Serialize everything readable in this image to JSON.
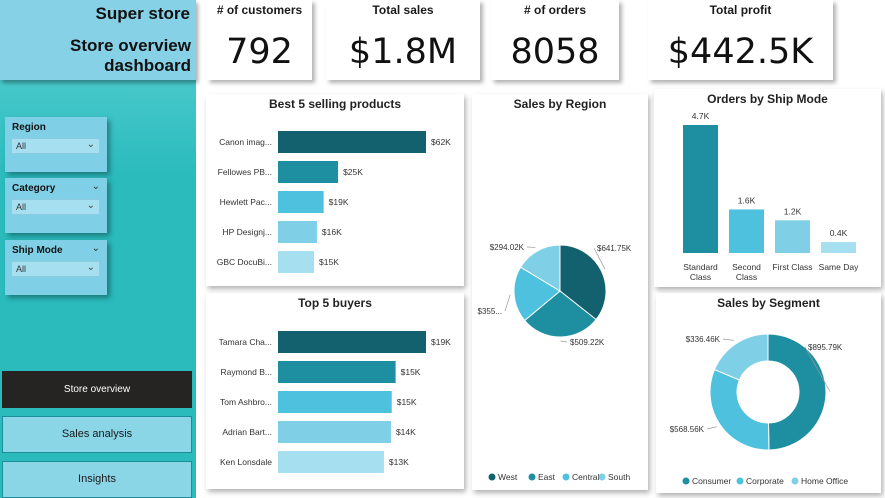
{
  "header": {
    "title_line1": "Super store",
    "title_line2": "Store overview",
    "title_line3": "dashboard"
  },
  "filters": [
    {
      "label": "Region",
      "value": "All",
      "header_chevron": false
    },
    {
      "label": "Category",
      "value": "All",
      "header_chevron": true
    },
    {
      "label": "Ship Mode",
      "value": "All",
      "header_chevron": true
    }
  ],
  "nav": [
    {
      "label": "Store overview",
      "active": true
    },
    {
      "label": "Sales analysis",
      "active": false
    },
    {
      "label": "Insights",
      "active": false
    }
  ],
  "kpis": [
    {
      "label": "# of customers",
      "value": "792"
    },
    {
      "label": "Total sales",
      "value": "$1.8M"
    },
    {
      "label": "# of orders",
      "value": "8058"
    },
    {
      "label": "Total profit",
      "value": "$442.5K"
    }
  ],
  "colors": {
    "accent_dark": "#13606e",
    "accent_mid": "#1e8fa0",
    "accent_light": "#4ec1df",
    "accent_lighter": "#7fd0e6",
    "accent_lightest": "#a6dff0",
    "sidebar": "#2bbbbd",
    "nav_active": "#252423"
  },
  "chart_data": [
    {
      "id": "best_products",
      "type": "bar",
      "orientation": "horizontal",
      "title": "Best 5 selling products",
      "categories": [
        "Canon imag...",
        "Fellowes PB...",
        "Hewlett Pac...",
        "HP Designj...",
        "GBC DocuBi..."
      ],
      "values": [
        61.6,
        25.0,
        19.0,
        16.2,
        15.0
      ],
      "labels": [
        "$62K",
        "$25K",
        "$19K",
        "$16K",
        "$15K"
      ],
      "colors": [
        "#13606e",
        "#1e8fa0",
        "#4ec1df",
        "#7fd0e6",
        "#a6dff0"
      ]
    },
    {
      "id": "top_buyers",
      "type": "bar",
      "orientation": "horizontal",
      "title": "Top 5 buyers",
      "categories": [
        "Tamara Cha...",
        "Raymond B...",
        "Tom Ashbro...",
        "Adrian Bart...",
        "Ken Lonsdale"
      ],
      "values": [
        19.0,
        15.1,
        14.6,
        14.5,
        13.6
      ],
      "labels": [
        "$19K",
        "$15K",
        "$15K",
        "$14K",
        "$13K"
      ],
      "colors": [
        "#13606e",
        "#1e8fa0",
        "#4ec1df",
        "#7fd0e6",
        "#a6dff0"
      ]
    },
    {
      "id": "sales_region",
      "type": "pie",
      "title": "Sales by Region",
      "categories": [
        "West",
        "East",
        "Central",
        "South"
      ],
      "values": [
        641.75,
        509.22,
        355.0,
        294.02
      ],
      "labels": [
        "$641.75K",
        "$509.22K",
        "$355...",
        "$294.02K"
      ],
      "colors": [
        "#13606e",
        "#1e8fa0",
        "#4ec1df",
        "#7fd0e6"
      ],
      "legend": "bottom"
    },
    {
      "id": "ship_mode",
      "type": "bar",
      "orientation": "vertical",
      "title": "Orders by Ship Mode",
      "categories": [
        "Standard Class",
        "Second Class",
        "First Class",
        "Same Day"
      ],
      "values": [
        4.7,
        1.6,
        1.2,
        0.4
      ],
      "labels": [
        "4.7K",
        "1.6K",
        "1.2K",
        "0.4K"
      ],
      "colors": [
        "#1e8fa0",
        "#4ec1df",
        "#7fd0e6",
        "#a6dff0"
      ]
    },
    {
      "id": "sales_segment",
      "type": "pie",
      "variant": "donut",
      "title": "Sales by Segment",
      "categories": [
        "Consumer",
        "Corporate",
        "Home Office"
      ],
      "values": [
        895.79,
        568.56,
        336.46
      ],
      "labels": [
        "$895.79K",
        "$568.56K",
        "$336.46K"
      ],
      "colors": [
        "#1e8fa0",
        "#4ec1df",
        "#7fd0e6"
      ],
      "legend": "bottom"
    }
  ]
}
